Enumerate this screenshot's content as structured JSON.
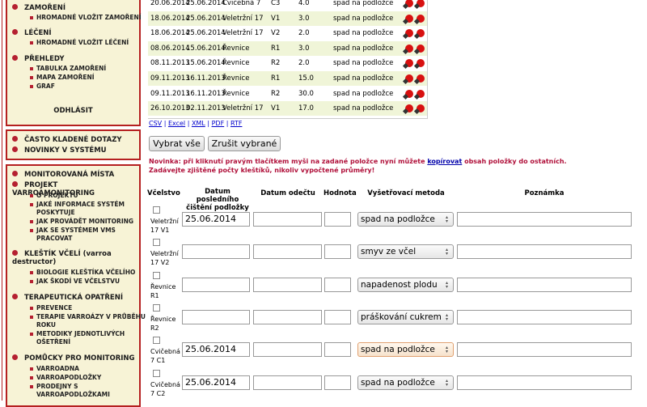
{
  "sidebar": {
    "box1": {
      "sections": [
        {
          "label": "ZAMOŘENÍ",
          "subs": [
            "HROMADNÉ VLOŽIT ZAMOŘENÍ"
          ]
        },
        {
          "label": "LÉČENÍ",
          "subs": [
            "HROMADNÉ VLOŽIT LÉČENÍ"
          ]
        },
        {
          "label": "PŘEHLEDY",
          "subs": [
            "TABULKA ZAMOŘENÍ",
            "MAPA ZAMOŘENÍ",
            "GRAF"
          ]
        }
      ],
      "logout": "ODHLÁSIT"
    },
    "box2": {
      "items": [
        "ČASTO KLADENÉ DOTAZY",
        "NOVINKY V SYSTÉMU"
      ]
    },
    "box3": {
      "s1": "MONITOROVANÁ MÍSTA",
      "s2": "PROJEKT VARROAMONITORING",
      "s2_subs": [
        "O PROJEKTU",
        "JAKÉ INFORMACE SYSTÉM POSKYTUJE",
        "JAK PROVÁDĚT MONITORING",
        "JAK SE SYSTÉMEM VMS PRACOVAT"
      ],
      "s3": "KLEŠTÍK VČELÍ (varroa destructor)",
      "s3_subs": [
        "BIOLOGIE KLEŠTÍKA VČELÍHO",
        "JAK ŠKODÍ VE VČELSTVU"
      ],
      "s4": "TERAPEUTICKÁ OPATŘENÍ",
      "s4_subs": [
        "PREVENCE",
        "TERAPIE VARROÁZY V PRŮBĚHU ROKU",
        "METODIKY JEDNOTLIVÝCH OŠETŘENÍ"
      ],
      "s5": "POMŮCKY PRO MONITORING",
      "s5_subs": [
        "VARROADNA",
        "VARROAPODLOŽKY",
        "PRODEJNY S VARROAPODLOŽKAMI"
      ]
    }
  },
  "table": {
    "rows": [
      {
        "d1": "20.06.2014",
        "d2": "25.06.2014",
        "place": "Cvičebná 7",
        "code": "C3",
        "val": "4.0",
        "method": "spad na podložce"
      },
      {
        "d1": "18.06.2014",
        "d2": "25.06.2014",
        "place": "Veletržní 17",
        "code": "V1",
        "val": "3.0",
        "method": "spad na podložce"
      },
      {
        "d1": "18.06.2014",
        "d2": "25.06.2014",
        "place": "Veletržní 17",
        "code": "V2",
        "val": "2.0",
        "method": "spad na podložce"
      },
      {
        "d1": "08.06.2014",
        "d2": "15.06.2014",
        "place": "Řevnice",
        "code": "R1",
        "val": "3.0",
        "method": "spad na podložce"
      },
      {
        "d1": "08.11.2013",
        "d2": "15.06.2014",
        "place": "Řevnice",
        "code": "R2",
        "val": "2.0",
        "method": "spad na podložce"
      },
      {
        "d1": "09.11.2013",
        "d2": "16.11.2013",
        "place": "Řevnice",
        "code": "R1",
        "val": "15.0",
        "method": "spad na podložce"
      },
      {
        "d1": "09.11.2013",
        "d2": "16.11.2013",
        "place": "Řevnice",
        "code": "R2",
        "val": "30.0",
        "method": "spad na podložce"
      },
      {
        "d1": "26.10.2013",
        "d2": "02.11.2013",
        "place": "Veletržní 17",
        "code": "V1",
        "val": "17.0",
        "method": "spad na podložce"
      }
    ]
  },
  "exports": [
    "CSV",
    "Excel",
    "XML",
    "PDF",
    "RTF"
  ],
  "buttons": {
    "select_all": "Vybrat vše",
    "deselect": "Zrušit vybrané"
  },
  "notice": {
    "part1": "Novinka: při kliknutí pravým tlačítkem myši na zadané položce nyní můžete ",
    "link": "kopírovat",
    "part2": " obsah položky do ostatních.",
    "line2": "Zadávejte zjištěné počty kleštíků, nikoliv vypočtené průměry!"
  },
  "form": {
    "headers": {
      "colony": "Včelstvo",
      "last_clean": "Datum posledního čištění podložky",
      "read_date": "Datum odečtu",
      "value": "Hodnota",
      "method": "Vyšetřovací metoda",
      "note": "Poznámka"
    },
    "rows": [
      {
        "label": "Veletržní 17 V1",
        "date": "25.06.2014",
        "method": "spad na podložce",
        "highlight": false
      },
      {
        "label": "Veletržní 17 V2",
        "date": "",
        "method": "smyv ze včel",
        "highlight": false
      },
      {
        "label": "Řevnice R1",
        "date": "",
        "method": "napadenost plodu",
        "highlight": false
      },
      {
        "label": "Řevnice R2",
        "date": "",
        "method": "práškování cukrem",
        "highlight": false
      },
      {
        "label": "Cvičebná 7 C1",
        "date": "25.06.2014",
        "method": "spad na podložce",
        "highlight": true
      },
      {
        "label": "Cvičebná 7 C2",
        "date": "25.06.2014",
        "method": "spad na podložce",
        "highlight": false
      }
    ]
  },
  "colors": {
    "accent": "#b52020",
    "sidebar_bg": "#f7f3d6",
    "row_alt": "#f0f5d8",
    "link": "#0000cc",
    "notice": "#b0103a"
  }
}
